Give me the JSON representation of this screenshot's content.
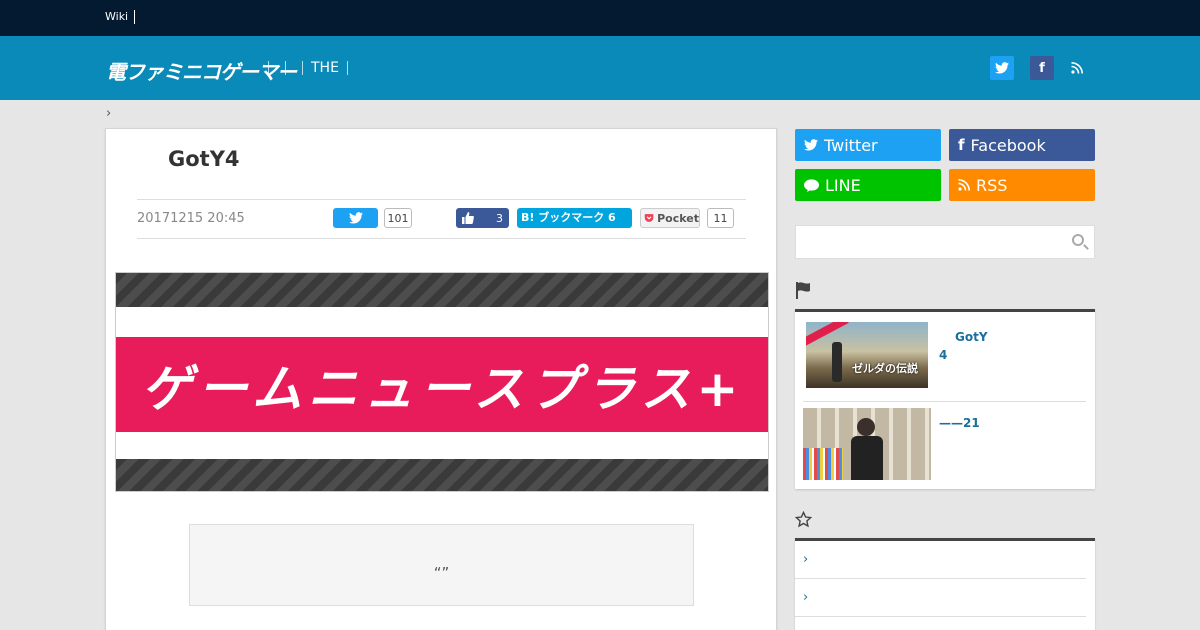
{
  "topbar": {
    "wiki_label": "Wiki"
  },
  "header": {
    "logo_text": "電ファミニコゲーマー",
    "nav_item": "THE",
    "social_twitter": "t",
    "social_facebook": "f",
    "social_rss": "rss"
  },
  "breadcrumb": {
    "chevron": "›"
  },
  "article": {
    "title": "GotY4",
    "date": "20171215 20:45",
    "share": {
      "twitter_count": "101",
      "like_count": "3",
      "hatena_label": "B! ブックマーク 6",
      "pocket_label": "Pocket",
      "pocket_count": "11"
    },
    "banner_text": "ゲームニュースプラス+",
    "quote_text": "“”"
  },
  "sidebar": {
    "buttons": {
      "twitter": "Twitter",
      "facebook": "Facebook",
      "line": "LINE",
      "rss": "RSS"
    },
    "ranking": [
      {
        "title_line1": "GotY",
        "title_line2": "4",
        "thumb_text": "ゼルダの伝説"
      },
      {
        "title_line1": "——21"
      }
    ],
    "list": [
      {
        "chevron": "›"
      },
      {
        "chevron": "›"
      }
    ]
  },
  "colors": {
    "topbar": "#031a30",
    "header": "#0a8ab8",
    "twitter": "#1da1f2",
    "facebook": "#3b5998",
    "line": "#00c300",
    "rss": "#ff8a00",
    "banner_pink": "#e81c5b"
  },
  "icons": [
    "twitter-icon",
    "facebook-icon",
    "rss-icon",
    "line-icon",
    "search-icon",
    "flag-icon",
    "star-icon",
    "thumbs-up-icon",
    "pocket-icon"
  ]
}
